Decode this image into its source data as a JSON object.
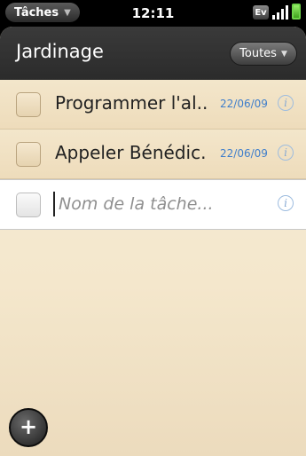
{
  "statusbar": {
    "app_menu_label": "Tâches",
    "time": "12:11",
    "network_badge": "Ev"
  },
  "header": {
    "title": "Jardinage",
    "filter_label": "Toutes"
  },
  "tasks": [
    {
      "title": "Programmer l'al...",
      "date": "22/06/09",
      "completed": false
    },
    {
      "title": "Appeler Bénédic...",
      "date": "22/06/09",
      "completed": false
    }
  ],
  "new_task": {
    "placeholder": "Nom de la tâche...",
    "value": ""
  },
  "icons": {
    "info": "info-icon",
    "add": "add-icon",
    "dropdown": "chevron-down-icon"
  },
  "colors": {
    "date_text": "#3f7ecb",
    "paper_background": "#f4e7cc",
    "header_background": "#2b2b2b"
  }
}
